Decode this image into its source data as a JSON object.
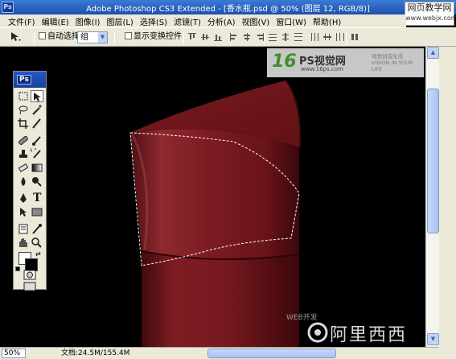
{
  "window": {
    "title": "Adobe Photoshop CS3 Extended - [香水瓶.psd @ 50% (图层 12, RGB/8)]",
    "icon": "Ps"
  },
  "watermark_top": {
    "line1": "网页教学网",
    "line2": "www.webjx.com"
  },
  "menu": {
    "items": [
      "文件(F)",
      "编辑(E)",
      "图像(I)",
      "图层(L)",
      "选择(S)",
      "滤镜(T)",
      "分析(A)",
      "视图(V)",
      "窗口(W)",
      "帮助(H)"
    ]
  },
  "options": {
    "auto_select_label": "自动选择:",
    "auto_select_value": "组",
    "show_transform_label": "显示变换控件"
  },
  "tools_palette": {
    "badge": "Ps",
    "type_tool_label": "T"
  },
  "logo": {
    "mark": "16",
    "name": "PS视觉网",
    "url": "www.16ps.com",
    "tagline": "视觉创造生活 VISION IN YOUR LIFE"
  },
  "brand": {
    "small": "WEB开发",
    "text": "阿里西西"
  },
  "status": {
    "zoom": "50%",
    "doc_info": "文档:24.5M/155.4M"
  },
  "colors": {
    "bottle_red": "#8a1e24",
    "canvas_bg": "#000000",
    "chrome_bg": "#ece9d8",
    "titlebar": "#1d4fae"
  }
}
